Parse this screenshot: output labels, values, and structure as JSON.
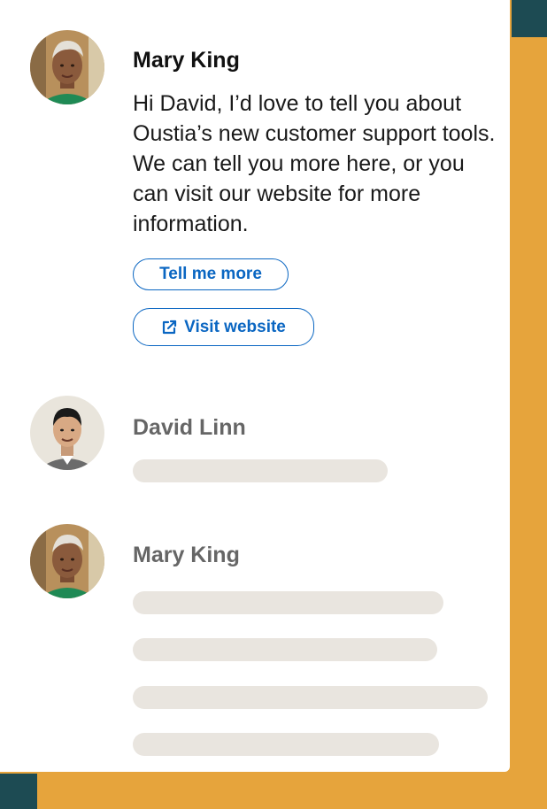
{
  "messages": [
    {
      "sender": "Mary King",
      "text": "Hi David, I’d love to tell you about Oustia’s new customer support tools. We can tell you more here, or you can visit our website for more information.",
      "buttons": [
        {
          "label": "Tell me more",
          "icon": null
        },
        {
          "label": "Visit website",
          "icon": "external-link-icon"
        }
      ]
    },
    {
      "sender": "David Linn"
    },
    {
      "sender": "Mary King"
    }
  ],
  "colors": {
    "background": "#1d4b53",
    "accent": "#e6a43c",
    "button": "#0a66c2",
    "placeholder": "#e9e5df"
  }
}
